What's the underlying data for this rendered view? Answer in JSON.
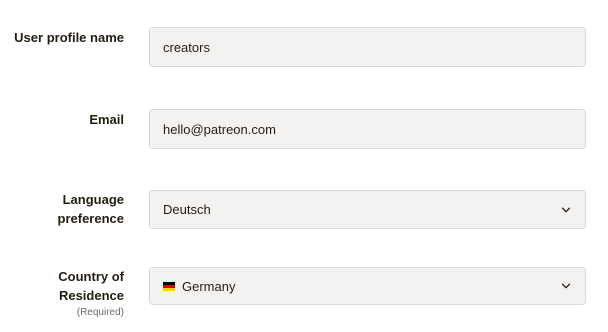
{
  "fields": {
    "profile_name": {
      "label": "User profile name",
      "value": "creators"
    },
    "email": {
      "label": "Email",
      "value": "hello@patreon.com"
    },
    "language": {
      "label_line1": "Language",
      "label_line2": "preference",
      "value": "Deutsch",
      "icon": "chevron-down-icon"
    },
    "country": {
      "label_line1": "Country of",
      "label_line2": "Residence",
      "sublabel": "(Required)",
      "value": "Germany",
      "flag_icon": "germany-flag-icon",
      "flag_colors": [
        "#000000",
        "#dd0000",
        "#ffce00"
      ],
      "icon": "chevron-down-icon"
    }
  }
}
